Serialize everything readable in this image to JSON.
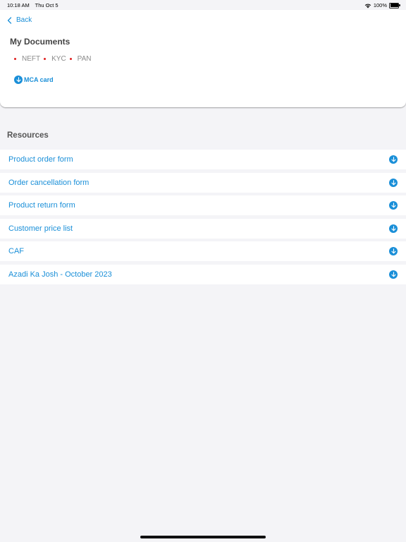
{
  "status_bar": {
    "time": "10:18 AM",
    "date": "Thu Oct 5",
    "battery": "100%"
  },
  "nav": {
    "back_label": "Back"
  },
  "documents": {
    "title": "My Documents",
    "tags": [
      "NEFT",
      "KYC",
      "PAN"
    ],
    "mca_label": "MCA card"
  },
  "resources": {
    "title": "Resources",
    "items": [
      {
        "label": "Product order form"
      },
      {
        "label": "Order cancellation form"
      },
      {
        "label": "Product return form"
      },
      {
        "label": "Customer price list"
      },
      {
        "label": "CAF"
      },
      {
        "label": "Azadi Ka Josh - October 2023"
      }
    ]
  },
  "colors": {
    "accent": "#1a8fd8",
    "tag_dot": "#e02020",
    "background": "#f4f4f7"
  }
}
